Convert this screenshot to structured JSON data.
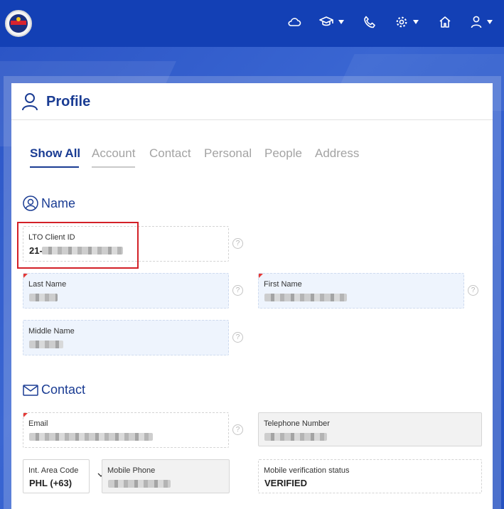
{
  "nav": {
    "icons": [
      "cloud-icon",
      "graduation-cap-icon",
      "phone-icon",
      "settings-icon",
      "home-icon",
      "user-icon"
    ]
  },
  "profile": {
    "title": "Profile"
  },
  "tabs": [
    {
      "label": "Show All",
      "active": true
    },
    {
      "label": "Account",
      "active": false
    },
    {
      "label": "Contact",
      "active": false
    },
    {
      "label": "Personal",
      "active": false
    },
    {
      "label": "People",
      "active": false
    },
    {
      "label": "Address",
      "active": false
    }
  ],
  "sections": {
    "name": {
      "title": "Name",
      "fields": {
        "client_id": {
          "label": "LTO Client ID",
          "value": "21-"
        },
        "last_name": {
          "label": "Last Name"
        },
        "first_name": {
          "label": "First Name"
        },
        "middle_name": {
          "label": "Middle Name"
        }
      }
    },
    "contact": {
      "title": "Contact",
      "fields": {
        "email": {
          "label": "Email"
        },
        "telephone": {
          "label": "Telephone Number"
        },
        "area_code": {
          "label": "Int. Area Code",
          "value": "PHL (+63)"
        },
        "mobile": {
          "label": "Mobile Phone"
        },
        "verification": {
          "label": "Mobile verification status",
          "value": "VERIFIED"
        }
      }
    }
  },
  "help_symbol": "?",
  "colors": {
    "topbar": "#1340b5",
    "accent": "#1a3c93",
    "highlight": "#d32027",
    "required": "#e53935"
  }
}
